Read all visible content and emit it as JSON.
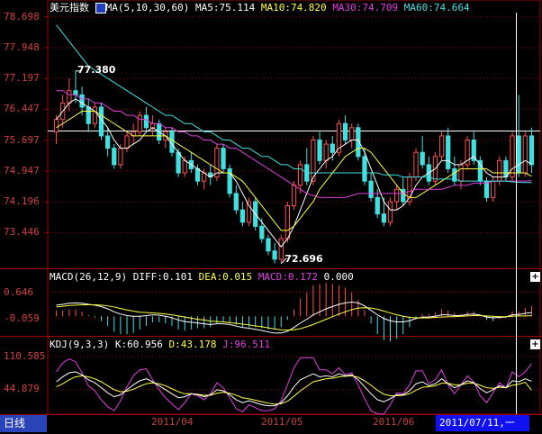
{
  "price_panel": {
    "title": "美元指数",
    "ma_label": "MA(5,10,30,60)",
    "ma5_text": "MA5:75.114",
    "ma10_text": "MA10:74.820",
    "ma30_text": "MA30:74.709",
    "ma60_text": "MA60:74.664",
    "y_labels": [
      "78.698",
      "77.948",
      "77.197",
      "76.447",
      "75.697",
      "74.947",
      "74.196",
      "73.446"
    ],
    "high_label": "77.380",
    "low_label": "72.696"
  },
  "macd_panel": {
    "label": "MACD(26,12,9)",
    "diff_text": "DIFF:0.101",
    "dea_text": "DEA:0.015",
    "macd_text": "MACD:0.172",
    "zero_text": "0.000",
    "y_labels": [
      "0.646",
      "-0.059"
    ]
  },
  "kdj_panel": {
    "label": "KDJ(9,3,3)",
    "k_text": "K:60.956",
    "d_text": "D:43.178",
    "j_text": "J:96.511",
    "y_labels": [
      "110.585",
      "44.879"
    ]
  },
  "footer": {
    "period_tab": "日线",
    "dates": [
      "2011/04",
      "2011/05",
      "2011/06"
    ],
    "cursor_date": "2011/07/11,一"
  },
  "colors": {
    "up": "#ff5050",
    "down": "#40e0e0",
    "ma5": "#ffffff",
    "ma10": "#ffff40",
    "ma30": "#e040e0",
    "ma60": "#40e0e0",
    "grid": "#a00000"
  },
  "chart_data": {
    "type": "candlestick",
    "ylim": [
      72.6,
      78.8
    ],
    "y_ticks": [
      78.698,
      77.948,
      77.197,
      76.447,
      75.697,
      74.947,
      74.196,
      73.446
    ],
    "candles": [
      [
        75.9,
        76.3,
        75.6,
        76.2
      ],
      [
        76.2,
        76.8,
        76.0,
        76.6
      ],
      [
        76.6,
        77.2,
        76.4,
        76.9
      ],
      [
        76.9,
        77.38,
        76.6,
        76.8
      ],
      [
        76.8,
        77.0,
        76.3,
        76.5
      ],
      [
        76.5,
        76.7,
        75.9,
        76.1
      ],
      [
        76.1,
        76.6,
        76.0,
        76.5
      ],
      [
        76.5,
        76.6,
        75.7,
        75.8
      ],
      [
        75.8,
        76.0,
        75.3,
        75.5
      ],
      [
        75.5,
        75.6,
        75.0,
        75.1
      ],
      [
        75.1,
        75.6,
        75.0,
        75.5
      ],
      [
        75.5,
        75.9,
        75.4,
        75.8
      ],
      [
        75.8,
        76.1,
        75.6,
        75.9
      ],
      [
        75.9,
        76.4,
        75.8,
        76.3
      ],
      [
        76.3,
        76.5,
        75.9,
        76.0
      ],
      [
        76.0,
        76.3,
        75.8,
        76.1
      ],
      [
        76.1,
        76.2,
        75.6,
        75.7
      ],
      [
        75.7,
        76.0,
        75.5,
        75.9
      ],
      [
        75.9,
        76.0,
        75.3,
        75.4
      ],
      [
        75.4,
        75.5,
        74.8,
        74.9
      ],
      [
        74.9,
        75.3,
        74.8,
        75.2
      ],
      [
        75.2,
        75.4,
        74.9,
        75.0
      ],
      [
        75.0,
        75.1,
        74.6,
        74.7
      ],
      [
        74.7,
        75.0,
        74.5,
        74.9
      ],
      [
        74.9,
        75.1,
        74.6,
        74.8
      ],
      [
        74.8,
        75.6,
        74.7,
        75.5
      ],
      [
        75.5,
        75.6,
        74.9,
        75.0
      ],
      [
        75.0,
        75.1,
        74.3,
        74.4
      ],
      [
        74.4,
        74.6,
        73.9,
        74.0
      ],
      [
        74.0,
        74.2,
        73.6,
        73.7
      ],
      [
        73.7,
        74.3,
        73.6,
        74.2
      ],
      [
        74.2,
        74.3,
        73.5,
        73.6
      ],
      [
        73.6,
        73.8,
        73.2,
        73.3
      ],
      [
        73.3,
        73.4,
        72.9,
        73.0
      ],
      [
        73.0,
        73.2,
        72.7,
        72.8
      ],
      [
        72.8,
        73.4,
        72.696,
        73.3
      ],
      [
        73.3,
        74.2,
        73.2,
        74.1
      ],
      [
        74.1,
        74.7,
        74.0,
        74.6
      ],
      [
        74.6,
        75.2,
        74.4,
        75.1
      ],
      [
        75.1,
        75.5,
        74.6,
        74.7
      ],
      [
        74.7,
        75.8,
        74.6,
        75.7
      ],
      [
        75.7,
        75.9,
        75.1,
        75.2
      ],
      [
        75.2,
        75.7,
        75.0,
        75.6
      ],
      [
        75.6,
        75.8,
        75.2,
        75.4
      ],
      [
        75.4,
        76.2,
        75.3,
        76.1
      ],
      [
        76.1,
        76.3,
        75.6,
        75.7
      ],
      [
        75.7,
        76.1,
        75.5,
        76.0
      ],
      [
        76.0,
        76.1,
        75.2,
        75.3
      ],
      [
        75.3,
        75.5,
        74.6,
        74.7
      ],
      [
        74.7,
        74.9,
        74.2,
        74.3
      ],
      [
        74.3,
        74.5,
        73.8,
        73.9
      ],
      [
        73.9,
        74.3,
        73.6,
        73.7
      ],
      [
        73.7,
        74.3,
        73.6,
        74.2
      ],
      [
        74.2,
        74.6,
        74.0,
        74.5
      ],
      [
        74.5,
        74.8,
        74.1,
        74.2
      ],
      [
        74.2,
        74.9,
        74.1,
        74.8
      ],
      [
        74.8,
        75.5,
        74.7,
        75.4
      ],
      [
        75.4,
        75.8,
        75.0,
        75.1
      ],
      [
        75.1,
        75.3,
        74.6,
        74.7
      ],
      [
        74.7,
        75.4,
        74.6,
        75.3
      ],
      [
        75.3,
        75.9,
        75.2,
        75.8
      ],
      [
        75.8,
        76.0,
        74.9,
        75.0
      ],
      [
        75.0,
        75.3,
        74.6,
        74.7
      ],
      [
        74.7,
        75.2,
        74.5,
        75.1
      ],
      [
        75.1,
        75.8,
        75.0,
        75.7
      ],
      [
        75.7,
        75.9,
        75.1,
        75.2
      ],
      [
        75.2,
        75.3,
        74.6,
        74.7
      ],
      [
        74.7,
        74.8,
        74.2,
        74.3
      ],
      [
        74.3,
        74.8,
        74.2,
        74.7
      ],
      [
        74.7,
        75.3,
        74.6,
        75.2
      ],
      [
        75.2,
        75.3,
        74.7,
        74.8
      ],
      [
        74.8,
        75.9,
        74.7,
        75.8
      ],
      [
        75.8,
        76.8,
        74.8,
        74.9
      ],
      [
        74.9,
        75.9,
        74.8,
        75.8
      ],
      [
        75.8,
        76.0,
        74.9,
        75.1
      ]
    ],
    "ma_series": [
      {
        "name": "MA5",
        "color": "#ffffff",
        "values": [
          76.2,
          76.4,
          76.6,
          76.7,
          76.6,
          76.5,
          76.4,
          76.2,
          76.0,
          75.7,
          75.5,
          75.5,
          75.6,
          75.7,
          75.9,
          76.0,
          75.9,
          75.8,
          75.6,
          75.4,
          75.2,
          75.1,
          75.0,
          74.9,
          74.8,
          74.9,
          74.9,
          74.9,
          74.7,
          74.4,
          74.1,
          73.9,
          73.7,
          73.5,
          73.3,
          73.1,
          73.3,
          73.6,
          74.0,
          74.4,
          74.8,
          75.0,
          75.2,
          75.3,
          75.5,
          75.6,
          75.7,
          75.7,
          75.4,
          75.0,
          74.6,
          74.2,
          74.0,
          74.0,
          74.1,
          74.3,
          74.6,
          74.8,
          74.9,
          75.0,
          75.2,
          75.2,
          75.1,
          75.1,
          75.2,
          75.3,
          75.1,
          74.9,
          74.8,
          74.8,
          74.8,
          75.0,
          75.1,
          75.2,
          75.114
        ]
      },
      {
        "name": "MA10",
        "color": "#ffff40",
        "values": [
          76.0,
          76.1,
          76.2,
          76.3,
          76.4,
          76.4,
          76.4,
          76.3,
          76.2,
          76.1,
          76.0,
          75.9,
          75.8,
          75.8,
          75.8,
          75.8,
          75.8,
          75.8,
          75.7,
          75.6,
          75.5,
          75.4,
          75.3,
          75.2,
          75.1,
          75.0,
          74.9,
          74.9,
          74.8,
          74.7,
          74.5,
          74.3,
          74.1,
          73.9,
          73.7,
          73.5,
          73.5,
          73.6,
          73.8,
          74.0,
          74.2,
          74.5,
          74.7,
          74.9,
          75.1,
          75.3,
          75.4,
          75.5,
          75.5,
          75.4,
          75.2,
          75.0,
          74.8,
          74.6,
          74.4,
          74.3,
          74.3,
          74.4,
          74.5,
          74.6,
          74.7,
          74.8,
          74.9,
          75.0,
          75.0,
          75.0,
          75.0,
          75.0,
          74.9,
          74.9,
          74.9,
          74.9,
          74.9,
          74.9,
          74.82
        ]
      },
      {
        "name": "MA30",
        "color": "#e040e0",
        "values": [
          76.9,
          76.9,
          76.8,
          76.8,
          76.7,
          76.7,
          76.6,
          76.6,
          76.5,
          76.4,
          76.4,
          76.3,
          76.3,
          76.2,
          76.2,
          76.1,
          76.1,
          76.0,
          76.0,
          75.9,
          75.9,
          75.8,
          75.8,
          75.7,
          75.7,
          75.6,
          75.6,
          75.5,
          75.5,
          75.4,
          75.3,
          75.2,
          75.1,
          75.0,
          74.9,
          74.8,
          74.7,
          74.6,
          74.5,
          74.4,
          74.35,
          74.3,
          74.3,
          74.3,
          74.3,
          74.3,
          74.35,
          74.4,
          74.4,
          74.4,
          74.4,
          74.4,
          74.4,
          74.4,
          74.4,
          74.45,
          74.5,
          74.5,
          74.5,
          74.5,
          74.5,
          74.55,
          74.6,
          74.6,
          74.6,
          74.65,
          74.65,
          74.65,
          74.7,
          74.7,
          74.7,
          74.7,
          74.7,
          74.7,
          74.709
        ]
      },
      {
        "name": "MA60",
        "color": "#40e0e0",
        "values": [
          78.5,
          78.3,
          78.1,
          77.9,
          77.7,
          77.5,
          77.4,
          77.3,
          77.2,
          77.1,
          77.0,
          76.9,
          76.8,
          76.7,
          76.6,
          76.5,
          76.4,
          76.3,
          76.3,
          76.2,
          76.1,
          76.1,
          76.0,
          75.9,
          75.9,
          75.8,
          75.7,
          75.7,
          75.6,
          75.5,
          75.5,
          75.4,
          75.3,
          75.3,
          75.2,
          75.1,
          75.1,
          75.0,
          75.0,
          74.9,
          74.9,
          74.9,
          74.9,
          74.9,
          74.9,
          74.9,
          74.9,
          74.9,
          74.9,
          74.9,
          74.9,
          74.85,
          74.85,
          74.85,
          74.8,
          74.8,
          74.8,
          74.8,
          74.8,
          74.75,
          74.75,
          74.75,
          74.75,
          74.7,
          74.7,
          74.7,
          74.7,
          74.7,
          74.7,
          74.7,
          74.7,
          74.68,
          74.67,
          74.665,
          74.664
        ]
      }
    ],
    "macd": {
      "ylim": [
        -0.5,
        0.9
      ],
      "zero": 0.0,
      "diff": [
        0.3,
        0.32,
        0.35,
        0.36,
        0.35,
        0.32,
        0.3,
        0.26,
        0.2,
        0.12,
        0.06,
        0.02,
        0.0,
        0.0,
        0.02,
        0.04,
        0.03,
        0.0,
        -0.04,
        -0.1,
        -0.14,
        -0.16,
        -0.18,
        -0.2,
        -0.22,
        -0.2,
        -0.2,
        -0.22,
        -0.26,
        -0.3,
        -0.32,
        -0.35,
        -0.38,
        -0.42,
        -0.45,
        -0.45,
        -0.4,
        -0.3,
        -0.18,
        -0.08,
        0.04,
        0.12,
        0.2,
        0.26,
        0.32,
        0.36,
        0.38,
        0.36,
        0.28,
        0.16,
        0.04,
        -0.06,
        -0.12,
        -0.15,
        -0.15,
        -0.12,
        -0.06,
        -0.02,
        -0.02,
        0.0,
        0.04,
        0.04,
        0.02,
        0.02,
        0.05,
        0.06,
        0.03,
        -0.02,
        -0.04,
        -0.03,
        -0.02,
        0.04,
        0.05,
        0.08,
        0.101
      ],
      "dea": [
        0.25,
        0.27,
        0.29,
        0.3,
        0.31,
        0.31,
        0.31,
        0.3,
        0.28,
        0.25,
        0.21,
        0.17,
        0.14,
        0.11,
        0.1,
        0.09,
        0.08,
        0.06,
        0.04,
        0.01,
        -0.02,
        -0.05,
        -0.08,
        -0.1,
        -0.13,
        -0.14,
        -0.15,
        -0.17,
        -0.19,
        -0.21,
        -0.23,
        -0.26,
        -0.28,
        -0.31,
        -0.34,
        -0.36,
        -0.37,
        -0.36,
        -0.33,
        -0.28,
        -0.22,
        -0.15,
        -0.08,
        -0.01,
        0.06,
        0.12,
        0.18,
        0.22,
        0.23,
        0.22,
        0.19,
        0.14,
        0.09,
        0.04,
        0.0,
        -0.03,
        -0.04,
        -0.04,
        -0.04,
        -0.03,
        -0.02,
        -0.01,
        -0.01,
        0.0,
        0.01,
        0.02,
        0.02,
        0.01,
        0.0,
        -0.01,
        -0.01,
        0.0,
        0.01,
        0.01,
        0.015
      ]
    },
    "kdj": {
      "ylim": [
        -5,
        125
      ],
      "k": [
        60,
        70,
        78,
        80,
        74,
        64,
        58,
        48,
        38,
        30,
        34,
        44,
        54,
        62,
        66,
        60,
        52,
        44,
        36,
        28,
        30,
        36,
        34,
        30,
        34,
        44,
        42,
        34,
        24,
        18,
        22,
        18,
        14,
        12,
        12,
        18,
        32,
        50,
        64,
        70,
        76,
        70,
        72,
        70,
        76,
        72,
        74,
        64,
        50,
        36,
        24,
        20,
        26,
        34,
        34,
        42,
        56,
        60,
        52,
        56,
        66,
        56,
        48,
        54,
        62,
        58,
        46,
        38,
        44,
        52,
        48,
        62,
        60,
        66,
        60.956
      ],
      "d": [
        50,
        56,
        64,
        70,
        72,
        70,
        66,
        60,
        52,
        44,
        40,
        41,
        45,
        51,
        56,
        58,
        56,
        52,
        46,
        40,
        36,
        36,
        35,
        33,
        33,
        37,
        39,
        37,
        33,
        28,
        26,
        23,
        20,
        17,
        15,
        16,
        21,
        31,
        42,
        51,
        60,
        63,
        66,
        67,
        70,
        71,
        72,
        69,
        62,
        53,
        43,
        35,
        32,
        32,
        33,
        36,
        43,
        49,
        50,
        52,
        57,
        57,
        54,
        54,
        57,
        57,
        53,
        48,
        47,
        49,
        48,
        53,
        55,
        59,
        43.178
      ],
      "j": [
        80,
        98,
        106,
        100,
        78,
        52,
        42,
        24,
        10,
        2,
        22,
        50,
        72,
        84,
        86,
        64,
        44,
        28,
        16,
        4,
        18,
        36,
        32,
        24,
        36,
        58,
        48,
        28,
        6,
        0,
        14,
        8,
        2,
        2,
        6,
        22,
        54,
        88,
        108,
        108,
        108,
        84,
        84,
        76,
        88,
        74,
        78,
        54,
        26,
        2,
        -4,
        -10,
        14,
        38,
        36,
        54,
        82,
        82,
        56,
        64,
        84,
        54,
        36,
        54,
        72,
        60,
        32,
        18,
        38,
        58,
        48,
        80,
        70,
        80,
        96.511
      ]
    }
  }
}
